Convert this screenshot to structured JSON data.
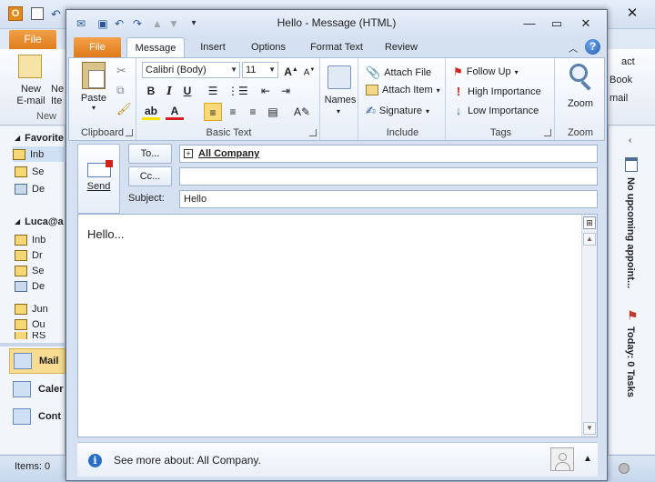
{
  "background_window": {
    "file_tab": "File",
    "ribbon": {
      "new_email": "New E-mail",
      "new_items_partial": "Ne Ite",
      "group_new": "New",
      "contact_partial": "act",
      "book_partial": "Book",
      "mail_partial": "mail"
    },
    "nav": {
      "favorites": "Favorite",
      "favorites_items": [
        "Inb",
        "Se",
        "De"
      ],
      "account": "Luca@a",
      "account_items": [
        "Inb",
        "Dr",
        "Se",
        "De",
        "Jun",
        "Ou",
        "RS"
      ],
      "big_buttons": [
        "Mail",
        "Caler",
        "Cont"
      ]
    },
    "todo_bar": {
      "appointments": "No upcoming appoint...",
      "tasks": "Today: 0 Tasks"
    },
    "status": {
      "items": "Items: 0"
    }
  },
  "message_window": {
    "title": "Hello - Message (HTML)",
    "tabs": [
      "File",
      "Message",
      "Insert",
      "Options",
      "Format Text",
      "Review"
    ],
    "ribbon": {
      "clipboard": {
        "label": "Clipboard",
        "paste": "Paste"
      },
      "basic_text": {
        "label": "Basic Text",
        "font_name": "Calibri (Body)",
        "font_size": "11",
        "bold": "B",
        "italic": "I",
        "underline": "U"
      },
      "names": {
        "label": "Names"
      },
      "include": {
        "label": "Include",
        "attach_file": "Attach File",
        "attach_item": "Attach Item",
        "signature": "Signature"
      },
      "tags": {
        "label": "Tags",
        "follow_up": "Follow Up",
        "high_importance": "High Importance",
        "low_importance": "Low Importance"
      },
      "zoom": {
        "label": "Zoom",
        "button": "Zoom"
      }
    },
    "compose": {
      "send": "Send",
      "to_button": "To...",
      "cc_button": "Cc...",
      "subject_label": "Subject:",
      "to_value": "All Company",
      "cc_value": "",
      "subject_value": "Hello",
      "body": "Hello..."
    },
    "people_pane": {
      "text": "See more about: All Company."
    }
  }
}
